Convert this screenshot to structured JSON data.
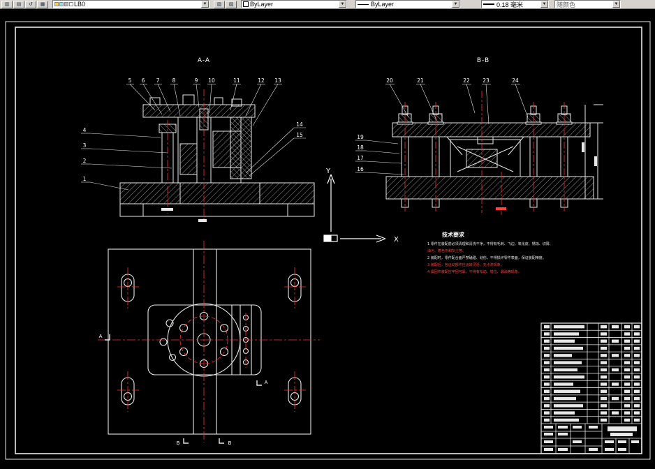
{
  "colors": {
    "background": "#000000",
    "line": "#e8e8e8",
    "centerline": "#ff3030",
    "toolbar_bg": "#d6d3ce"
  },
  "toolbar": {
    "left_icons": [
      {
        "name": "make-object-layer-current-icon",
        "glyph": "▥"
      },
      {
        "name": "layer-manager-icon",
        "glyph": "▤"
      },
      {
        "name": "layer-previous-icon",
        "glyph": "↺"
      },
      {
        "name": "layer-states-icon",
        "glyph": "▦"
      }
    ],
    "mid_icons": [
      {
        "name": "layers-icon",
        "glyph": "▧"
      },
      {
        "name": "layer-isolate-icon",
        "glyph": "▨"
      }
    ],
    "layer_combo": {
      "value": "LB0"
    },
    "color_combo": {
      "value": "ByLayer"
    },
    "linetype_combo": {
      "value": "ByLayer"
    },
    "lineweight_combo": {
      "value": "0.18 毫米"
    },
    "plotstyle_combo": {
      "value": "随颜色"
    }
  },
  "views": {
    "aa": {
      "title": "A-A",
      "top_labels": [
        "5",
        "6",
        "7",
        "8",
        "9",
        "10",
        "11",
        "12",
        "13"
      ],
      "left_labels": [
        "4",
        "3",
        "2",
        "1"
      ],
      "right_labels": [
        "14",
        "15"
      ]
    },
    "bb": {
      "title": "B-B",
      "top_labels": [
        "20",
        "21",
        "22",
        "23",
        "24"
      ],
      "left_labels": [
        "19",
        "18",
        "17",
        "16"
      ]
    },
    "plan": {
      "marks": [
        "A",
        "A",
        "B",
        "B"
      ]
    }
  },
  "ucs": {
    "x_label": "X",
    "y_label": "Y"
  },
  "tech": {
    "title": "技术要求",
    "lines": [
      {
        "text": "1 零件在装配前必须清理和清洗干净，不得有毛刺、飞边、氧化皮、锈蚀、切屑、",
        "color": "#e8e8e8"
      },
      {
        "text": "油污、着色剂和灰尘等。",
        "color": "#ff4040"
      },
      {
        "text": "2 装配时，零件配合面严禁磕碰、划伤，不得损坏零件表面，保证装配精度。",
        "color": "#e8e8e8"
      },
      {
        "text": "3 装配后，各运动部件应运转灵活，无卡滞现象。",
        "color": "#ff4040"
      },
      {
        "text": "4 紧固件装配应牢固可靠，不得有松动、错位、漏油等现象。",
        "color": "#ff4040"
      }
    ]
  }
}
